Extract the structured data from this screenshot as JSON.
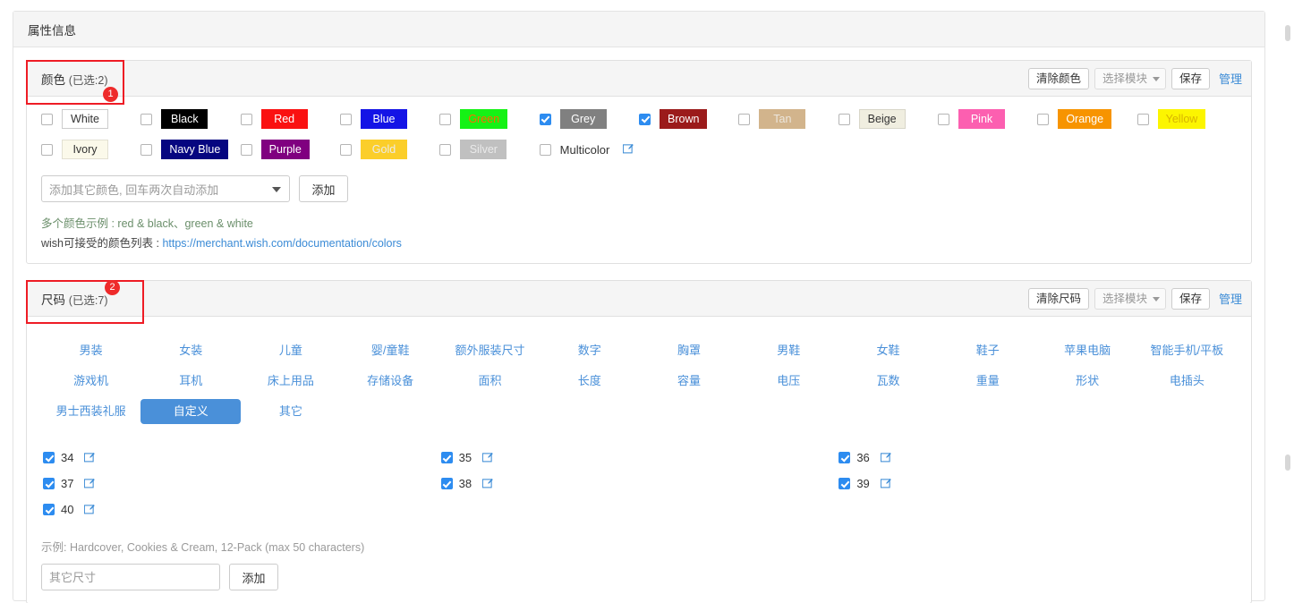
{
  "panel": {
    "title": "属性信息"
  },
  "annotations": [
    {
      "id": "1",
      "target": "color-card-header"
    },
    {
      "id": "2",
      "target": "size-card-header"
    }
  ],
  "color_section": {
    "title": "颜色",
    "count_label": "(已选:2)",
    "actions": {
      "clear": "清除颜色",
      "module": "选择模块",
      "save": "保存",
      "manage": "管理"
    },
    "swatches": [
      {
        "label": "White",
        "checked": false,
        "bg": "#ffffff",
        "fg": "#333333",
        "border": "#cccccc"
      },
      {
        "label": "Black",
        "checked": false,
        "bg": "#000000",
        "fg": "#ffffff",
        "border": "#000000"
      },
      {
        "label": "Red",
        "checked": false,
        "bg": "#fa1111",
        "fg": "#ffffff",
        "border": "#fa1111"
      },
      {
        "label": "Blue",
        "checked": false,
        "bg": "#1414e6",
        "fg": "#ffffff",
        "border": "#1414e6"
      },
      {
        "label": "Green",
        "checked": false,
        "bg": "#15f215",
        "fg": "#ff6a00",
        "border": "#15f215"
      },
      {
        "label": "Grey",
        "checked": true,
        "bg": "#808080",
        "fg": "#ffffff",
        "border": "#808080"
      },
      {
        "label": "Brown",
        "checked": true,
        "bg": "#9b1b1b",
        "fg": "#ffffff",
        "border": "#9b1b1b"
      },
      {
        "label": "Tan",
        "checked": false,
        "bg": "#d2b48c",
        "fg": "#ece6dc",
        "border": "#d2b48c"
      },
      {
        "label": "Beige",
        "checked": false,
        "bg": "#f0eee0",
        "fg": "#333333",
        "border": "#d8d6c8"
      },
      {
        "label": "Pink",
        "checked": false,
        "bg": "#fc5fb0",
        "fg": "#ffffff",
        "border": "#fc5fb0"
      },
      {
        "label": "Orange",
        "checked": false,
        "bg": "#f79400",
        "fg": "#ffffff",
        "border": "#f79400"
      },
      {
        "label": "Yellow",
        "checked": false,
        "bg": "#fcf500",
        "fg": "#d8b400",
        "border": "#fcf500"
      },
      {
        "label": "Ivory",
        "checked": false,
        "bg": "#fbf9ea",
        "fg": "#333333",
        "border": "#e2e0d2"
      },
      {
        "label": "Navy Blue",
        "checked": false,
        "bg": "#060680",
        "fg": "#ffffff",
        "border": "#060680"
      },
      {
        "label": "Purple",
        "checked": false,
        "bg": "#800080",
        "fg": "#ffffff",
        "border": "#800080"
      },
      {
        "label": "Gold",
        "checked": false,
        "bg": "#fbce2a",
        "fg": "#ebebeb",
        "border": "#fbce2a"
      },
      {
        "label": "Silver",
        "checked": false,
        "bg": "#c0c0c0",
        "fg": "#eaeaea",
        "border": "#c0c0c0"
      }
    ],
    "multicolor": {
      "label": "Multicolor",
      "checked": false,
      "edit_icon": "edit-icon"
    },
    "add_row": {
      "placeholder": "添加其它颜色, 回车两次自动添加",
      "value": "",
      "add_label": "添加"
    },
    "hints": {
      "line1": "多个颜色示例 : red & black、green & white",
      "line2_prefix": "wish可接受的颜色列表 : ",
      "line2_link": "https://merchant.wish.com/documentation/colors"
    }
  },
  "size_section": {
    "title": "尺码",
    "count_label": "(已选:7)",
    "actions": {
      "clear": "清除尺码",
      "module": "选择模块",
      "save": "保存",
      "manage": "管理"
    },
    "tabs": [
      {
        "label": "男装",
        "active": false
      },
      {
        "label": "女装",
        "active": false
      },
      {
        "label": "儿童",
        "active": false
      },
      {
        "label": "婴/童鞋",
        "active": false
      },
      {
        "label": "额外服装尺寸",
        "active": false
      },
      {
        "label": "数字",
        "active": false
      },
      {
        "label": "胸罩",
        "active": false
      },
      {
        "label": "男鞋",
        "active": false
      },
      {
        "label": "女鞋",
        "active": false
      },
      {
        "label": "鞋子",
        "active": false
      },
      {
        "label": "苹果电脑",
        "active": false
      },
      {
        "label": "智能手机/平板",
        "active": false
      },
      {
        "label": "游戏机",
        "active": false
      },
      {
        "label": "耳机",
        "active": false
      },
      {
        "label": "床上用品",
        "active": false
      },
      {
        "label": "存储设备",
        "active": false
      },
      {
        "label": "面积",
        "active": false
      },
      {
        "label": "长度",
        "active": false
      },
      {
        "label": "容量",
        "active": false
      },
      {
        "label": "电压",
        "active": false
      },
      {
        "label": "瓦数",
        "active": false
      },
      {
        "label": "重量",
        "active": false
      },
      {
        "label": "形状",
        "active": false
      },
      {
        "label": "电插头",
        "active": false
      },
      {
        "label": "男士西装礼服",
        "active": false
      },
      {
        "label": "自定义",
        "active": true
      },
      {
        "label": "其它",
        "active": false
      }
    ],
    "sizes": [
      {
        "label": "34",
        "checked": true
      },
      {
        "label": "35",
        "checked": true
      },
      {
        "label": "36",
        "checked": true
      },
      {
        "label": "37",
        "checked": true
      },
      {
        "label": "38",
        "checked": true
      },
      {
        "label": "39",
        "checked": true
      },
      {
        "label": "40",
        "checked": true
      }
    ],
    "example_text": "示例: Hardcover, Cookies & Cream, 12-Pack (max 50 characters)",
    "add_row": {
      "placeholder": "其它尺寸",
      "value": "",
      "add_label": "添加"
    }
  },
  "theme": {
    "accent_blue": "#4a90d9",
    "link_blue": "#3b8bd6",
    "checkbox_blue": "#2d8cf0",
    "annotation_red": "#ee1c25",
    "panel_head_bg": "#f5f5f5",
    "border": "#e0e0e0"
  }
}
